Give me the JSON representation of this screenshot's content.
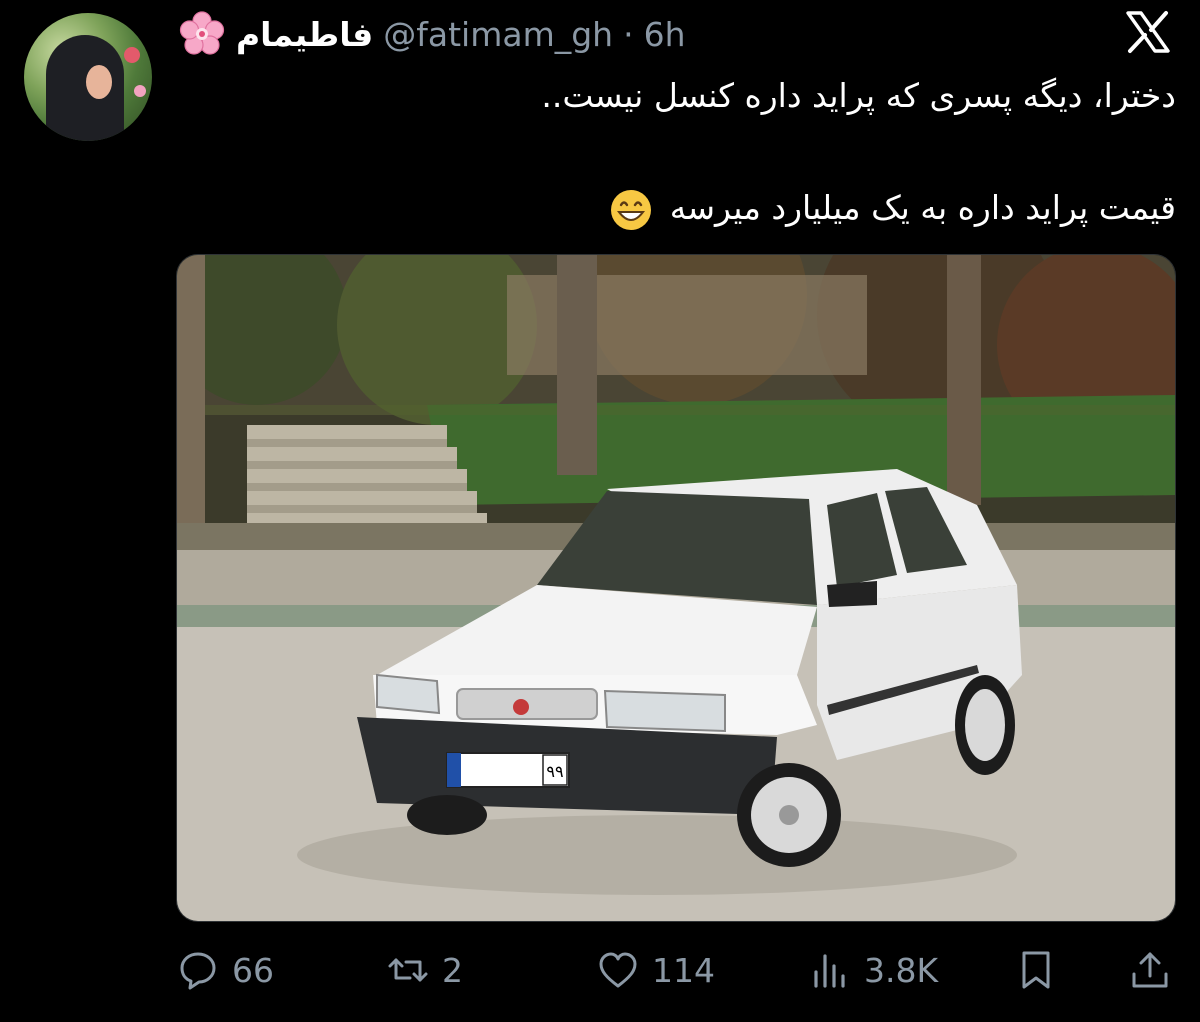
{
  "author": {
    "display_name": "فاطیمام",
    "name_emoji": "cherry-blossom-icon",
    "handle": "@fatimam_gh",
    "separator": "·",
    "time": "6h"
  },
  "platform": "x-logo-icon",
  "tweet": {
    "line1": "دخترا، دیگه پسری که پراید داره کنسل نیست..",
    "line2": "قیمت پراید داره به یک میلیارد میرسه",
    "emoji": "grinning-face-icon"
  },
  "media": {
    "image": "white-pride-sedan-photo",
    "plate_number": "۹۹"
  },
  "actions": {
    "replies": "66",
    "reposts": "2",
    "likes": "114",
    "views": "3.8K"
  },
  "colors": {
    "background": "#000000",
    "text": "#ffffff",
    "muted": "#8b98a5"
  }
}
